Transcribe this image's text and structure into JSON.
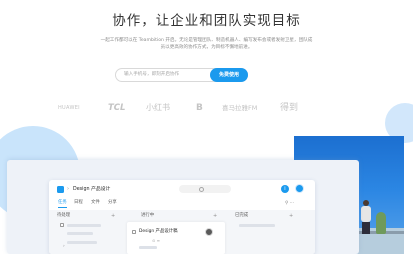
{
  "hero": {
    "title": "协作，让企业和团队实现目标",
    "description": "一起工作都可以在 Teambition 开启。无论是管理团队、制造机器人、编写发布会或者发射卫星，团队成员以更高效的协作方式，为目标不懈地前进。"
  },
  "signup": {
    "placeholder": "输入手机号，即刻开启协作",
    "button_label": "免费使用"
  },
  "logos": [
    {
      "name": "HUAWEI",
      "color": "#c4c4c4"
    },
    {
      "name": "TCL",
      "color": "#c4c4c4"
    },
    {
      "name": "小红书",
      "color": "#c4c4c4"
    },
    {
      "name": "B",
      "color": "#c4c4c4"
    },
    {
      "name": "喜马拉雅FM",
      "color": "#c4c4c4"
    },
    {
      "name": "得到",
      "color": "#c4c4c4"
    }
  ],
  "app": {
    "breadcrumb_separator": "›",
    "project_name": "Design 产品设计",
    "info_icon": "i",
    "tabs": [
      "任务",
      "日程",
      "文件",
      "分享"
    ],
    "tools": "⚲  ⋯",
    "columns": [
      {
        "title": "待处理",
        "add": "+"
      },
      {
        "title": "进行中",
        "add": "+"
      },
      {
        "title": "已完成",
        "add": "+"
      }
    ],
    "task": {
      "title": "Design 产品设计稿",
      "meta": "⊙ ≡"
    },
    "collapse_marker": "›"
  },
  "colors": {
    "accent": "#1b9aee",
    "circle": "#c9e4fb",
    "photo_sky": "#2b86e3"
  }
}
